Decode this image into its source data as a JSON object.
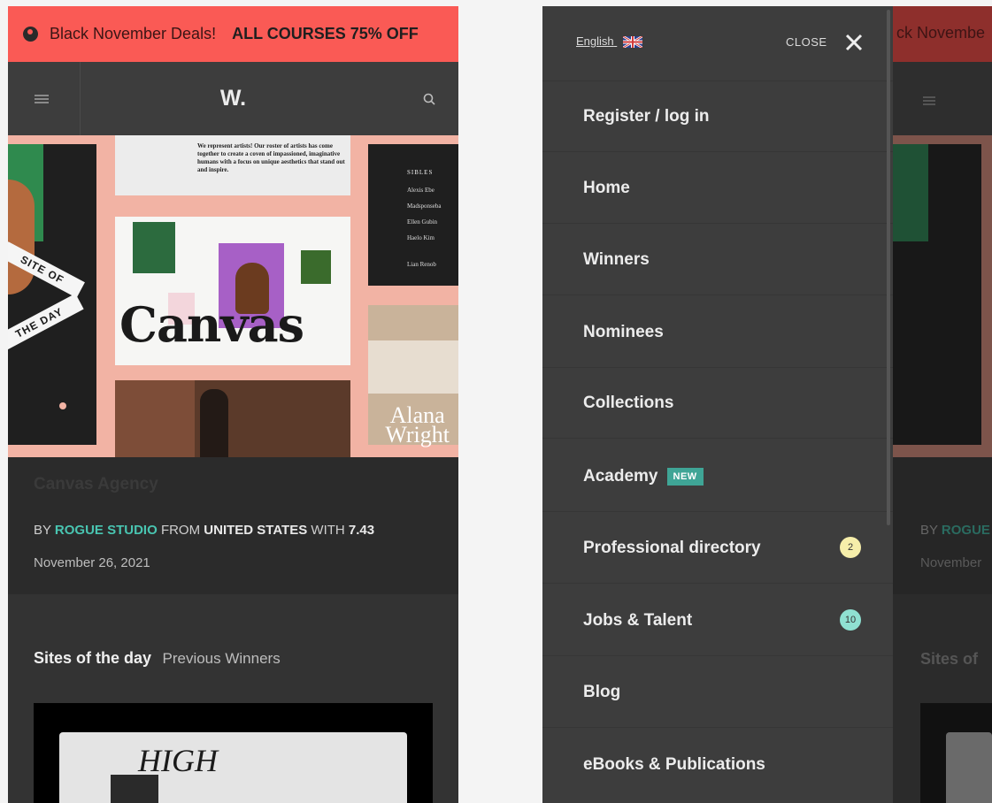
{
  "left": {
    "promo": {
      "label": "Black November Deals!",
      "deal": "ALL COURSES 75% OFF"
    },
    "header": {
      "logo": "W."
    },
    "hero": {
      "blurb": "We represent artists! Our roster of artists has come together to create a coven of impassioned, imaginative humans with a focus on unique aesthetics that stand out and inspire.",
      "canvas_word": "Canvas",
      "alana_line1": "Alana",
      "alana_line2": "Wright",
      "ribbon_1": "SITE OF",
      "ribbon_2": "THE DAY",
      "sidebar_title": "SIBLES",
      "sidebar_names": [
        "Alexis Ebe",
        "Madsponseba",
        "Ellen Gubin",
        "Haelo Kim",
        "Lian Renob"
      ]
    },
    "site": {
      "name": "Canvas Agency",
      "by": "BY",
      "author": "ROGUE STUDIO",
      "from": "FROM",
      "country": "UNITED STATES",
      "with": "WITH",
      "score": "7.43",
      "date": "November 26, 2021"
    },
    "section": {
      "title": "Sites of the day",
      "subtitle": "Previous Winners"
    },
    "thumb": {
      "text": "HIGH"
    }
  },
  "right": {
    "background": {
      "promo_fragment": "ck Novembe",
      "by_fragment": "BY",
      "author_fragment": "ROGUE",
      "date_fragment": "November",
      "section_fragment": "Sites of"
    },
    "menu": {
      "language": "English",
      "close_label": "CLOSE",
      "items": [
        {
          "label": "Register / log in"
        },
        {
          "label": "Home"
        },
        {
          "label": "Winners"
        },
        {
          "label": "Nominees"
        },
        {
          "label": "Collections"
        },
        {
          "label": "Academy",
          "badge": "NEW"
        },
        {
          "label": "Professional directory",
          "count": "2"
        },
        {
          "label": "Jobs & Talent",
          "count": "10"
        },
        {
          "label": "Blog"
        },
        {
          "label": "eBooks & Publications"
        }
      ]
    }
  },
  "colors": {
    "promo_bg": "#fa5a55",
    "accent": "#49c5b1",
    "badge_new": "#3fa596",
    "badge_yellow": "#f6eeaa",
    "badge_teal": "#8fe1d2"
  },
  "icons": [
    "promo-icon",
    "hamburger-icon",
    "search-icon",
    "uk-flag-icon",
    "close-icon"
  ]
}
